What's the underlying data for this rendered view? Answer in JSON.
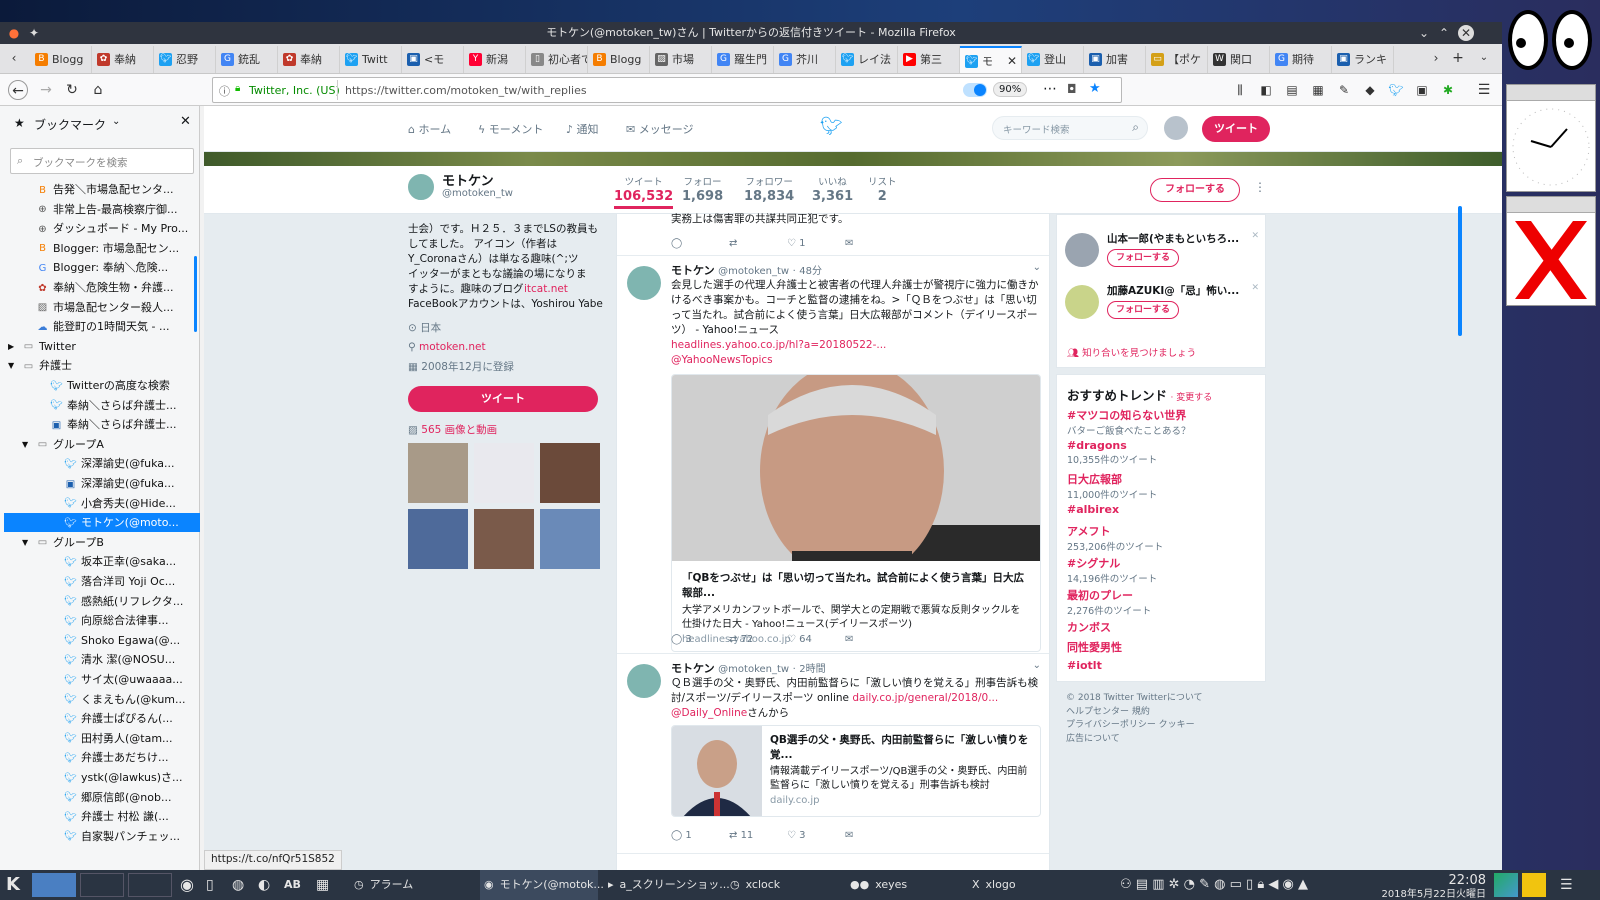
{
  "window": {
    "title": "モトケン(@motoken_tw)さん | Twitterからの返信付きツイート - Mozilla Firefox"
  },
  "tabs": [
    {
      "label": "Blogg",
      "icon": "blogger-icon",
      "color": "#f57d00"
    },
    {
      "label": "奉納",
      "icon": "blog-icon",
      "color": "#c0392b"
    },
    {
      "label": "忍野",
      "icon": "twitter-icon",
      "color": "#1da1f2"
    },
    {
      "label": "銃乱",
      "icon": "google-icon",
      "color": "#4285f4"
    },
    {
      "label": "奉納",
      "icon": "blog-icon",
      "color": "#c0392b"
    },
    {
      "label": "Twitt",
      "icon": "twitter-icon",
      "color": "#1da1f2"
    },
    {
      "label": "<モ",
      "icon": "site-icon",
      "color": "#1b5fae"
    },
    {
      "label": "新潟",
      "icon": "yahoo-icon",
      "color": "#ff0033"
    },
    {
      "label": "初心者で",
      "icon": "page-icon",
      "color": "#888888"
    },
    {
      "label": "Blogg",
      "icon": "blogger-icon",
      "color": "#f57d00"
    },
    {
      "label": "市場",
      "icon": "image-icon",
      "color": "#666666"
    },
    {
      "label": "羅生門",
      "icon": "google-icon",
      "color": "#4285f4"
    },
    {
      "label": "芥川",
      "icon": "google-icon",
      "color": "#4285f4"
    },
    {
      "label": "レイ法",
      "icon": "twitter-icon",
      "color": "#1da1f2"
    },
    {
      "label": "第三",
      "icon": "youtube-icon",
      "color": "#ff0000"
    },
    {
      "label": "モ",
      "icon": "twitter-icon",
      "color": "#1da1f2",
      "active": true
    },
    {
      "label": "登山",
      "icon": "twitter-icon",
      "color": "#1da1f2"
    },
    {
      "label": "加害",
      "icon": "site-icon",
      "color": "#1b5fae"
    },
    {
      "label": "【ポケ",
      "icon": "folder-icon",
      "color": "#d4a017"
    },
    {
      "label": "関口",
      "icon": "wikipedia-icon",
      "color": "#333333"
    },
    {
      "label": "期待",
      "icon": "google-icon",
      "color": "#4285f4"
    },
    {
      "label": "ランキ",
      "icon": "site-icon",
      "color": "#1b5fae"
    }
  ],
  "navbar": {
    "identity": "Twitter, Inc. (US)",
    "url": "https://twitter.com/motoken_tw/with_replies",
    "zoom": "90%"
  },
  "sidebar": {
    "title": "ブックマーク",
    "search_placeholder": "ブックマークを検索",
    "items": [
      {
        "label": "告発＼市場急配センタ...",
        "icon": "blogger-icon",
        "color": "#f57d00",
        "indent": 2
      },
      {
        "label": "非常上告-最高検察庁御...",
        "icon": "globe-icon",
        "color": "#555555",
        "indent": 2
      },
      {
        "label": "ダッシュボード - My Pro...",
        "icon": "globe-icon",
        "color": "#555555",
        "indent": 2
      },
      {
        "label": "Blogger: 市場急配セン...",
        "icon": "blogger-icon",
        "color": "#f57d00",
        "indent": 2
      },
      {
        "label": "Blogger: 奉納＼危険...",
        "icon": "google-icon",
        "color": "#4285f4",
        "indent": 2
      },
      {
        "label": "奉納＼危険生物・弁護...",
        "icon": "blog-icon",
        "color": "#c0392b",
        "indent": 2
      },
      {
        "label": "市場急配センター殺人...",
        "icon": "image-icon",
        "color": "#666666",
        "indent": 2
      },
      {
        "label": "能登町の1時間天気 - ...",
        "icon": "weather-icon",
        "color": "#3b7dd8",
        "indent": 2
      },
      {
        "label": "Twitter",
        "icon": "folder-icon",
        "color": "#777777",
        "indent": 1,
        "arrow": "▶"
      },
      {
        "label": "弁護士",
        "icon": "folder-icon",
        "color": "#777777",
        "indent": 1,
        "arrow": "▼"
      },
      {
        "label": "Twitterの高度な検索",
        "icon": "twitter-icon",
        "color": "#1da1f2",
        "indent": 3
      },
      {
        "label": "奉納＼さらば弁護士...",
        "icon": "twitter-icon",
        "color": "#1da1f2",
        "indent": 3
      },
      {
        "label": "奉納＼さらば弁護士...",
        "icon": "site-icon",
        "color": "#1b5fae",
        "indent": 3
      },
      {
        "label": "グループA",
        "icon": "folder-icon",
        "color": "#777777",
        "indent": 2,
        "arrow": "▼"
      },
      {
        "label": "深澤諭史(@fuka...",
        "icon": "twitter-icon",
        "color": "#1da1f2",
        "indent": 4
      },
      {
        "label": "深澤諭史(@fuka...",
        "icon": "site-icon",
        "color": "#1b5fae",
        "indent": 4
      },
      {
        "label": "小倉秀夫(@Hide...",
        "icon": "twitter-icon",
        "color": "#1da1f2",
        "indent": 4
      },
      {
        "label": "モトケン(@moto...",
        "icon": "twitter-icon",
        "color": "#1da1f2",
        "indent": 4,
        "selected": true
      },
      {
        "label": "グループB",
        "icon": "folder-icon",
        "color": "#777777",
        "indent": 2,
        "arrow": "▼"
      },
      {
        "label": "坂本正幸(@saka...",
        "icon": "twitter-icon",
        "color": "#1da1f2",
        "indent": 4
      },
      {
        "label": "落合洋司 Yoji Oc...",
        "icon": "twitter-icon",
        "color": "#1da1f2",
        "indent": 4
      },
      {
        "label": "感熱紙(リフレクタ...",
        "icon": "twitter-icon",
        "color": "#1da1f2",
        "indent": 4
      },
      {
        "label": "向原総合法律事...",
        "icon": "twitter-icon",
        "color": "#1da1f2",
        "indent": 4
      },
      {
        "label": "Shoko Egawa(@...",
        "icon": "twitter-icon",
        "color": "#1da1f2",
        "indent": 4
      },
      {
        "label": "清水 潔(@NOSU...",
        "icon": "twitter-icon",
        "color": "#1da1f2",
        "indent": 4
      },
      {
        "label": "サイ太(@uwaaaa...",
        "icon": "twitter-icon",
        "color": "#1da1f2",
        "indent": 4
      },
      {
        "label": "くまえもん(@kum...",
        "icon": "twitter-icon",
        "color": "#1da1f2",
        "indent": 4
      },
      {
        "label": "弁護士ぱぴるん(...",
        "icon": "twitter-icon",
        "color": "#1da1f2",
        "indent": 4
      },
      {
        "label": "田村勇人(@tam...",
        "icon": "twitter-icon",
        "color": "#1da1f2",
        "indent": 4
      },
      {
        "label": "弁護士あだちけ...",
        "icon": "twitter-icon",
        "color": "#1da1f2",
        "indent": 4
      },
      {
        "label": "ystk(@lawkus)さ...",
        "icon": "twitter-icon",
        "color": "#1da1f2",
        "indent": 4
      },
      {
        "label": "郷原信郎(@nob...",
        "icon": "twitter-icon",
        "color": "#1da1f2",
        "indent": 4
      },
      {
        "label": "弁護士 村松 謙(...",
        "icon": "twitter-icon",
        "color": "#1da1f2",
        "indent": 4
      },
      {
        "label": "自家製パンチェッ...",
        "icon": "twitter-icon",
        "color": "#1da1f2",
        "indent": 4
      }
    ]
  },
  "twitter": {
    "nav": {
      "home": "ホーム",
      "moments": "モーメント",
      "notifications": "通知",
      "messages": "メッセージ",
      "search_placeholder": "キーワード検索",
      "tweet_button": "ツイート"
    },
    "profile": {
      "name": "モトケン",
      "handle": "@motoken_tw",
      "follow_button": "フォローする"
    },
    "stats": [
      {
        "label": "ツイート",
        "value": "106,532"
      },
      {
        "label": "フォロー",
        "value": "1,698"
      },
      {
        "label": "フォロワー",
        "value": "18,834"
      },
      {
        "label": "いいね",
        "value": "3,361"
      },
      {
        "label": "リスト",
        "value": "2"
      }
    ],
    "bio": {
      "lines": [
        "士会）です。Ｈ２５．３までLSの教員も",
        "してました。 アイコン（作者は",
        "Y_Coronaさん）は単なる趣味(^;ツ",
        "イッターがまともな議論の場になりま",
        "すように。趣味のブログ"
      ],
      "blog_link": "itcat.net",
      "facebook": "FaceBookアカウントは、Yoshirou Yabe",
      "location": "日本",
      "website": "motoken.net",
      "joined": "2008年12月に登録",
      "tweet_button": "ツイート",
      "media": "565 画像と動画"
    },
    "tweets": [
      {
        "partial_text": "実務上は傷害罪の共謀共同正犯です。",
        "reply": "",
        "retweet": "",
        "like": "1"
      },
      {
        "name": "モトケン",
        "handle": "@motoken_tw",
        "time": "48分",
        "text": "会見した選手の代理人弁護士と被害者の代理人弁護士が警視庁に強力に働きかけるべき事案かも。コーチと監督の逮捕をね。>「ＱＢをつぶせ」は「思い切って当たれ。試合前によく使う言葉」日大広報部がコメント（デイリースポーツ） - Yahoo!ニュース",
        "link": "headlines.yahoo.co.jp/hl?a=20180522-...",
        "mention": "@YahooNewsTopics",
        "card_title": "「QBをつぶせ」は「思い切って当たれ。試合前によく使う言葉」日大広報部...",
        "card_desc": "大学アメリカンフットボールで、関学大との定期戦で悪質な反則タックルを仕掛けた日大 - Yahoo!ニュース(デイリースポーツ)",
        "card_domain": "headlines.yahoo.co.jp",
        "reply": "3",
        "retweet": "72",
        "like": "64"
      },
      {
        "name": "モトケン",
        "handle": "@motoken_tw",
        "time": "2時間",
        "text": "ＱＢ選手の父・奥野氏、内田前監督らに「激しい憤りを覚える」刑事告訴も検討/スポーツ/デイリースポーツ online",
        "link": "daily.co.jp/general/2018/0...",
        "mention": "@Daily_Online",
        "mention_suffix": "さんから",
        "card_title": "QB選手の父・奥野氏、内田前監督らに「激しい憤りを覚...",
        "card_desc": "情報満載デイリースポーツ/QB選手の父・奥野氏、内田前監督らに「激しい憤りを覚える」刑事告訴も検討",
        "card_domain": "daily.co.jp",
        "reply": "1",
        "retweet": "11",
        "like": "3"
      }
    ],
    "who_to_follow": [
      {
        "name": "山本一郎(やまもといちろ...",
        "button": "フォローする"
      },
      {
        "name": "加藤AZUKI@「忌」怖い...",
        "button": "フォローする"
      }
    ],
    "find_people": "知り合いを見つけましょう",
    "trends_title": "おすすめトレンド",
    "trends_change": "· 変更する",
    "trends": [
      {
        "tag": "#マツコの知らない世界",
        "count": "バターご飯食べたことある？"
      },
      {
        "tag": "#dragons",
        "count": "10,355件のツイート"
      },
      {
        "tag": "日大広報部",
        "count": "11,000件のツイート"
      },
      {
        "tag": "#albirex",
        "count": ""
      },
      {
        "tag": "アメフト",
        "count": "253,206件のツイート"
      },
      {
        "tag": "#シグナル",
        "count": "14,196件のツイート"
      },
      {
        "tag": "最初のプレー",
        "count": "2,276件のツイート"
      },
      {
        "tag": "カンボス",
        "count": ""
      },
      {
        "tag": "同性愛男性",
        "count": ""
      },
      {
        "tag": "#iotlt",
        "count": ""
      }
    ],
    "footer": [
      "© 2018 Twitter  Twitterについて",
      "ヘルプセンター  規約",
      "プライバシーポリシー  クッキー",
      "広告について"
    ]
  },
  "statusbar": {
    "url": "https://t.co/nfQr51S852"
  },
  "taskbar": {
    "items": [
      "アラーム",
      "モトケン(@motok...",
      "a_スクリーンショッ...",
      "xclock",
      "xeyes",
      "xlogo"
    ],
    "time": "22:08",
    "date": "2018年5月22日火曜日"
  },
  "colors": {
    "accent": "#e0245e",
    "link": "#1da1f2",
    "firefox_blue": "#0a84ff"
  }
}
